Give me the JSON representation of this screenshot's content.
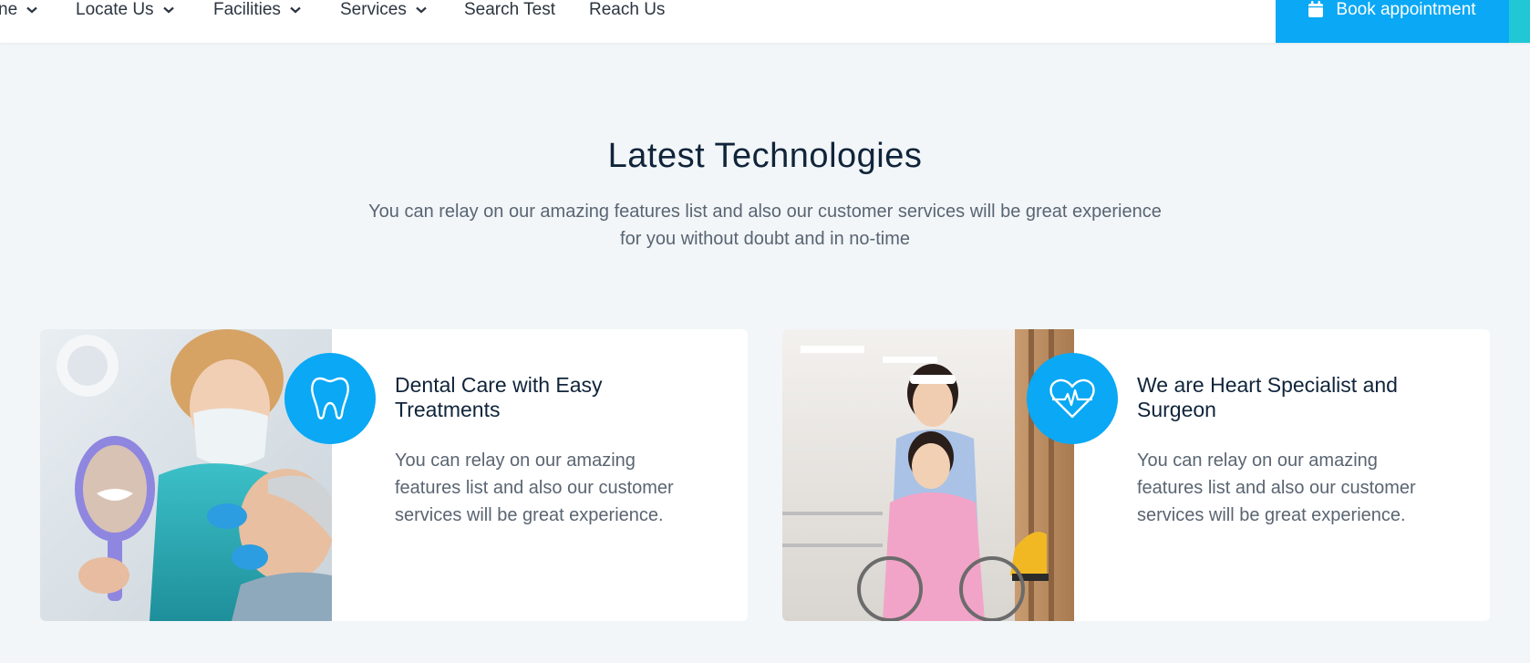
{
  "nav": {
    "items": [
      {
        "label": "ne",
        "has_dropdown": true
      },
      {
        "label": "Locate Us",
        "has_dropdown": true
      },
      {
        "label": "Facilities",
        "has_dropdown": true
      },
      {
        "label": "Services",
        "has_dropdown": true
      },
      {
        "label": "Search Test",
        "has_dropdown": false
      },
      {
        "label": "Reach Us",
        "has_dropdown": false
      }
    ],
    "book_button": {
      "label": "Book appointment",
      "icon": "calendar-icon"
    }
  },
  "section": {
    "title": "Latest Technologies",
    "subtitle": "You can relay on our amazing features list and also our customer services will be great experience for you without doubt and in no-time"
  },
  "cards": [
    {
      "title": "Dental Care with Easy Treatments",
      "text": "You can relay on our amazing features list and also our customer services will be great experience.",
      "icon": "tooth-icon",
      "image": "dentist-with-patient-photo"
    },
    {
      "title": "We are Heart Specialist and Surgeon",
      "text": "You can relay on our amazing features list and also our customer services will be great experience.",
      "icon": "heartbeat-icon",
      "image": "nurse-with-wheelchair-patient-photo"
    }
  ],
  "colors": {
    "accent": "#0aa8f5",
    "accent_edge": "#22c7d6",
    "page_bg": "#f2f6f9",
    "heading": "#10243a",
    "body_text": "#5a6572"
  }
}
